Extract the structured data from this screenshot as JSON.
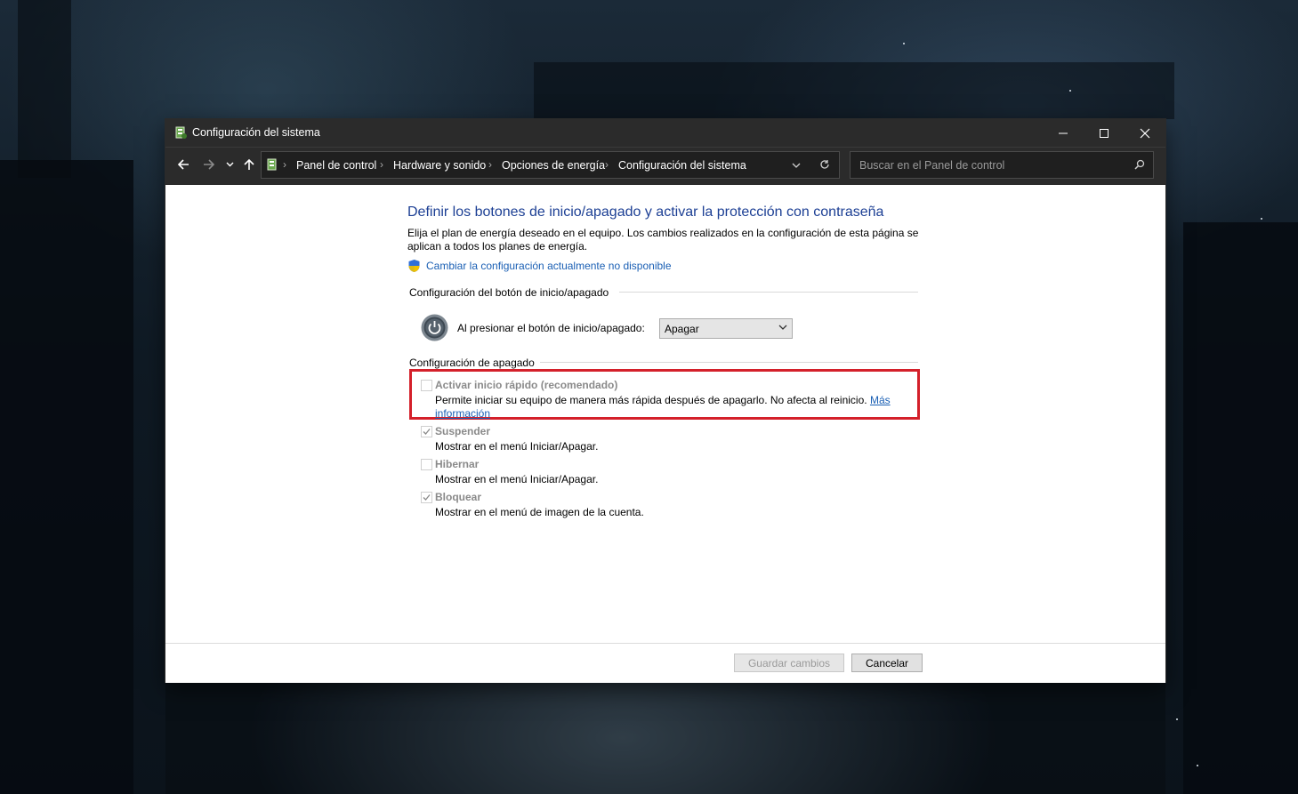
{
  "window": {
    "title": "Configuración del sistema",
    "controls": [
      "minimize-icon",
      "maximize-icon",
      "close-icon"
    ]
  },
  "navigation": {
    "breadcrumbs": [
      "Panel de control",
      "Hardware y sonido",
      "Opciones de energía",
      "Configuración del sistema"
    ],
    "search_placeholder": "Buscar en el Panel de control"
  },
  "page": {
    "heading": "Definir los botones de inicio/apagado y activar la protección con contraseña",
    "description": "Elija el plan de energía deseado en el equipo. Los cambios realizados en la configuración de esta página se aplican a todos los planes de energía.",
    "change_link": "Cambiar la configuración actualmente no disponible",
    "power_button_group": "Configuración del botón de inicio/apagado",
    "power_button_label": "Al presionar el botón de inicio/apagado:",
    "power_button_value": "Apagar",
    "shutdown_group": "Configuración de apagado",
    "options": [
      {
        "title": "Activar inicio rápido (recomendado)",
        "checked": false,
        "desc": "Permite iniciar su equipo de manera más rápida después de apagarlo. No afecta al reinicio. ",
        "link1": "Más",
        "link2": "información"
      },
      {
        "title": "Suspender",
        "checked": true,
        "desc": "Mostrar en el menú Iniciar/Apagar."
      },
      {
        "title": "Hibernar",
        "checked": false,
        "desc": "Mostrar en el menú Iniciar/Apagar."
      },
      {
        "title": "Bloquear",
        "checked": true,
        "desc": "Mostrar en el menú de imagen de la cuenta."
      }
    ]
  },
  "footer": {
    "save_label": "Guardar cambios",
    "cancel_label": "Cancelar"
  },
  "colors": {
    "heading": "#1c3f94",
    "link": "#1a5fb4",
    "highlight": "#d4202a",
    "titlebar": "#2b2b2b"
  }
}
